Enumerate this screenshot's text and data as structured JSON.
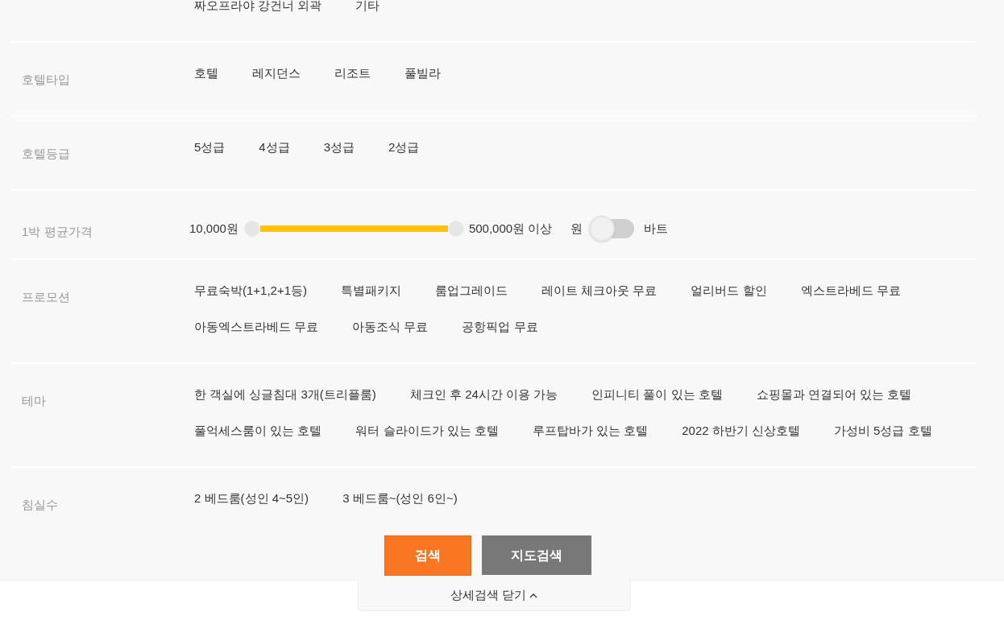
{
  "rows": [
    {
      "kind": "options",
      "label": "",
      "options": [
        "짜오프라야 강건너 외곽",
        "기타"
      ]
    },
    {
      "kind": "options",
      "label": "호텔타입",
      "options": [
        "호텔",
        "레지던스",
        "리조트",
        "풀빌라"
      ]
    },
    {
      "kind": "options",
      "label": "호텔등급",
      "options": [
        "5성급",
        "4성급",
        "3성급",
        "2성급"
      ]
    },
    {
      "kind": "range",
      "label": "1박 평균가격",
      "min_text": "10,000원",
      "max_text": "500,000원 이상",
      "level": 1,
      "currency_left": "원",
      "currency_on": false,
      "currency_right": "바트"
    },
    {
      "kind": "options",
      "label": "프로모션",
      "options": [
        "무료숙박(1+1,2+1등)",
        "특별패키지",
        "룸업그레이드",
        "레이트 체크아웃 무료",
        "얼리버드 할인",
        "엑스트라베드 무료",
        "아동엑스트라베드 무료",
        "아동조식 무료",
        "공항픽업 무료"
      ]
    },
    {
      "kind": "options",
      "label": "테마",
      "options": [
        "한 객실에 싱글침대 3개(트리플룸)",
        "체크인 후 24시간 이용 가능",
        "인피니티 풀이 있는 호텔",
        "쇼핑몰과 연결되어 있는 호텔",
        "풀억세스룸이 있는 호텔",
        "워터 슬라이드가 있는 호텔",
        "루프탑바가 있는 호텔",
        "2022 하반기 신상호텔",
        "가성비 5성급 호텔"
      ]
    },
    {
      "kind": "options",
      "label": "침실수",
      "options": [
        "2 베드룸(성인 4~5인)",
        "3 베드룸~(성인 6인~)"
      ]
    }
  ],
  "buttons": [
    {
      "label": "검색",
      "kind": "primary"
    },
    {
      "label": "지도검색",
      "kind": "secondary"
    }
  ],
  "close_tab": {
    "label": "상세검색 닫기"
  }
}
